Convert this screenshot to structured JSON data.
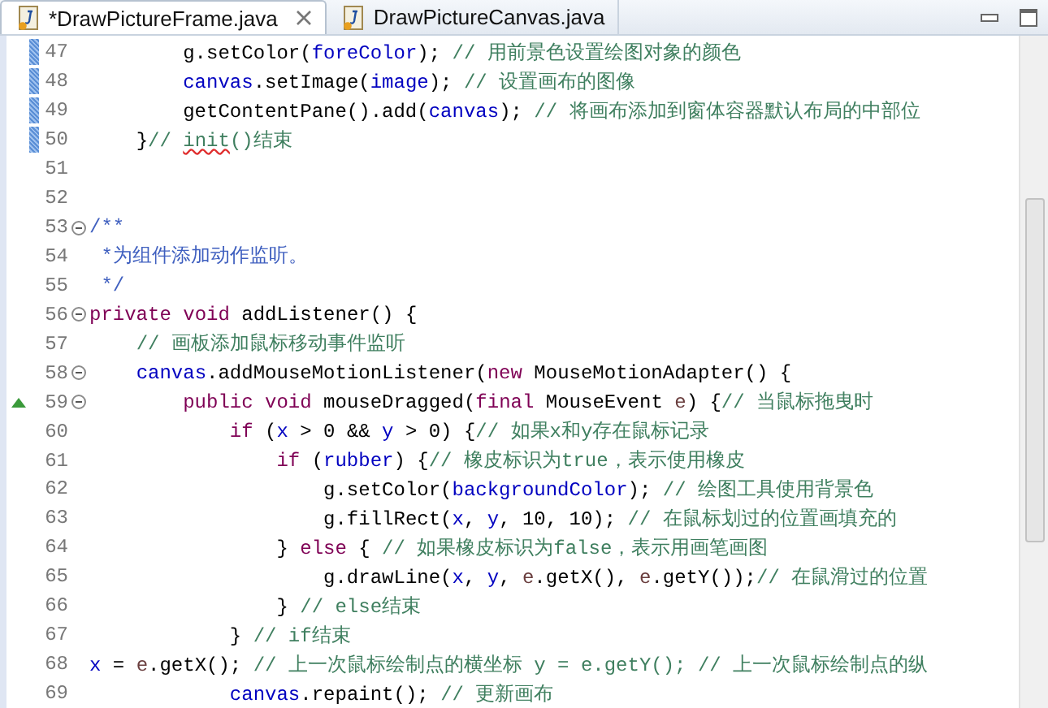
{
  "tabs": [
    {
      "label": "*DrawPictureFrame.java",
      "selected": true
    },
    {
      "label": "DrawPictureCanvas.java",
      "selected": false
    }
  ],
  "lines": [
    {
      "number": "47",
      "changed": true,
      "segments": [
        {
          "kind": "plain",
          "text": "        g.setColor("
        },
        {
          "kind": "field",
          "text": "foreColor"
        },
        {
          "kind": "plain",
          "text": "); "
        },
        {
          "kind": "comment",
          "text": "// 用前景色设置绘图对象的颜色"
        }
      ]
    },
    {
      "number": "48",
      "changed": true,
      "segments": [
        {
          "kind": "field",
          "text": "        canvas"
        },
        {
          "kind": "plain",
          "text": ".setImage("
        },
        {
          "kind": "field",
          "text": "image"
        },
        {
          "kind": "plain",
          "text": "); "
        },
        {
          "kind": "comment",
          "text": "// 设置画布的图像"
        }
      ]
    },
    {
      "number": "49",
      "changed": true,
      "segments": [
        {
          "kind": "plain",
          "text": "        getContentPane().add("
        },
        {
          "kind": "field",
          "text": "canvas"
        },
        {
          "kind": "plain",
          "text": "); "
        },
        {
          "kind": "comment",
          "text": "// 将画布添加到窗体容器默认布局的中部位"
        }
      ]
    },
    {
      "number": "50",
      "changed": true,
      "segments": [
        {
          "kind": "plain",
          "text": "    }"
        },
        {
          "kind": "comment",
          "text": "// "
        },
        {
          "kind": "misspelled",
          "text": "init"
        },
        {
          "kind": "comment",
          "text": "()结束"
        }
      ]
    },
    {
      "number": "51",
      "changed": false
    },
    {
      "number": "52",
      "changed": false
    },
    {
      "number": "53",
      "changed": false,
      "fold_expanded": true,
      "segments": [
        {
          "kind": "javadoc",
          "text": "/**"
        }
      ]
    },
    {
      "number": "54",
      "changed": false,
      "segments": [
        {
          "kind": "javadoc",
          "text": " *为组件添加动作监听。"
        }
      ]
    },
    {
      "number": "55",
      "changed": false,
      "segments": [
        {
          "kind": "javadoc",
          "text": " */"
        }
      ]
    },
    {
      "number": "56",
      "changed": false,
      "fold_expanded": true,
      "segments": [
        {
          "kind": "keyword",
          "text": "private"
        },
        {
          "kind": "keyword",
          "text": " void"
        },
        {
          "kind": "plain",
          "text": " addListener() {"
        }
      ]
    },
    {
      "number": "57",
      "changed": false,
      "segments": [
        {
          "kind": "comment",
          "text": "    // 画板添加鼠标移动事件监听"
        }
      ]
    },
    {
      "number": "58",
      "changed": false,
      "fold_expanded": true,
      "segments": [
        {
          "kind": "field",
          "text": "    canvas"
        },
        {
          "kind": "plain",
          "text": ".addMouseMotionListener("
        },
        {
          "kind": "keyword",
          "text": "new"
        },
        {
          "kind": "plain",
          "text": " MouseMotionAdapter() {"
        }
      ]
    },
    {
      "number": "59",
      "changed": false,
      "fold_expanded": true,
      "override": true,
      "segments": [
        {
          "kind": "keyword",
          "text": "        public"
        },
        {
          "kind": "keyword",
          "text": " void"
        },
        {
          "kind": "plain",
          "text": " mouseDragged("
        },
        {
          "kind": "keyword",
          "text": "final"
        },
        {
          "kind": "plain",
          "text": " MouseEvent "
        },
        {
          "kind": "param",
          "text": "e"
        },
        {
          "kind": "plain",
          "text": ") {"
        },
        {
          "kind": "comment",
          "text": "// 当鼠标拖曳时"
        }
      ]
    },
    {
      "number": "60",
      "changed": false,
      "segments": [
        {
          "kind": "keyword",
          "text": "            if"
        },
        {
          "kind": "plain",
          "text": " ("
        },
        {
          "kind": "field",
          "text": "x"
        },
        {
          "kind": "plain",
          "text": " > 0 && "
        },
        {
          "kind": "field",
          "text": "y"
        },
        {
          "kind": "plain",
          "text": " > 0) {"
        },
        {
          "kind": "comment",
          "text": "// 如果x和y存在鼠标记录"
        }
      ]
    },
    {
      "number": "61",
      "changed": false,
      "segments": [
        {
          "kind": "keyword",
          "text": "                if"
        },
        {
          "kind": "plain",
          "text": " ("
        },
        {
          "kind": "field",
          "text": "rubber"
        },
        {
          "kind": "plain",
          "text": ") {"
        },
        {
          "kind": "comment",
          "text": "// 橡皮标识为true，表示使用橡皮"
        }
      ]
    },
    {
      "number": "62",
      "changed": false,
      "segments": [
        {
          "kind": "plain",
          "text": "                    g.setColor("
        },
        {
          "kind": "field",
          "text": "backgroundColor"
        },
        {
          "kind": "plain",
          "text": "); "
        },
        {
          "kind": "comment",
          "text": "// 绘图工具使用背景色"
        }
      ]
    },
    {
      "number": "63",
      "changed": false,
      "segments": [
        {
          "kind": "plain",
          "text": "                    g.fillRect("
        },
        {
          "kind": "field",
          "text": "x"
        },
        {
          "kind": "plain",
          "text": ", "
        },
        {
          "kind": "field",
          "text": "y"
        },
        {
          "kind": "plain",
          "text": ", 10, 10); "
        },
        {
          "kind": "comment",
          "text": "// 在鼠标划过的位置画填充的"
        }
      ]
    },
    {
      "number": "64",
      "changed": false,
      "segments": [
        {
          "kind": "plain",
          "text": "                } "
        },
        {
          "kind": "keyword",
          "text": "else"
        },
        {
          "kind": "plain",
          "text": " { "
        },
        {
          "kind": "comment",
          "text": "// 如果橡皮标识为false，表示用画笔画图"
        }
      ]
    },
    {
      "number": "65",
      "changed": false,
      "segments": [
        {
          "kind": "plain",
          "text": "                    g.drawLine("
        },
        {
          "kind": "field",
          "text": "x"
        },
        {
          "kind": "plain",
          "text": ", "
        },
        {
          "kind": "field",
          "text": "y"
        },
        {
          "kind": "plain",
          "text": ", "
        },
        {
          "kind": "param",
          "text": "e"
        },
        {
          "kind": "plain",
          "text": ".getX(), "
        },
        {
          "kind": "param",
          "text": "e"
        },
        {
          "kind": "plain",
          "text": ".getY());"
        },
        {
          "kind": "comment",
          "text": "// 在鼠滑过的位置"
        }
      ]
    },
    {
      "number": "66",
      "changed": false,
      "segments": [
        {
          "kind": "plain",
          "text": "                } "
        },
        {
          "kind": "comment",
          "text": "// else结束"
        }
      ]
    },
    {
      "number": "67",
      "changed": false,
      "segments": [
        {
          "kind": "plain",
          "text": "            } "
        },
        {
          "kind": "comment",
          "text": "// if结束"
        }
      ]
    },
    {
      "number": "68",
      "changed": false,
      "segments": [
        {
          "kind": "field",
          "text": "x"
        },
        {
          "kind": "plain",
          "text": " = "
        },
        {
          "kind": "param",
          "text": "e"
        },
        {
          "kind": "plain",
          "text": ".getX(); "
        },
        {
          "kind": "comment",
          "text": "// 上一次鼠标绘制点的横坐标 y = e.getY(); // 上一次鼠标绘制点的纵"
        }
      ]
    },
    {
      "number": "69",
      "changed": false,
      "segments": [
        {
          "kind": "field",
          "text": "            canvas"
        },
        {
          "kind": "plain",
          "text": ".repaint(); "
        },
        {
          "kind": "comment",
          "text": "// 更新画布"
        }
      ]
    }
  ]
}
